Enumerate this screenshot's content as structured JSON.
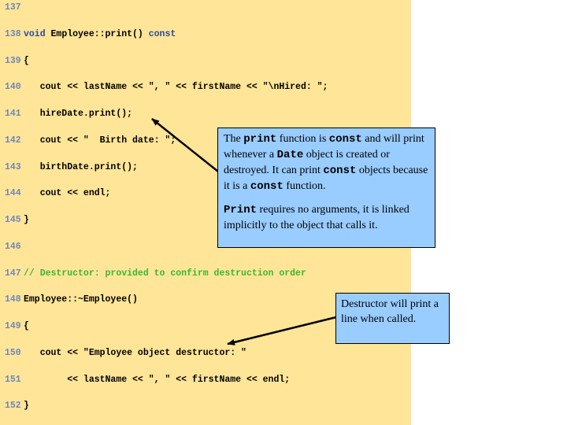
{
  "code": {
    "lines": [
      {
        "num": "137",
        "text": ""
      },
      {
        "num": "138",
        "kw1": "void ",
        "text": "Employee::print() ",
        "kw2": "const"
      },
      {
        "num": "139",
        "text": "{"
      },
      {
        "num": "140",
        "text": "   cout << lastName << \", \" << firstName << \"\\nHired: \";"
      },
      {
        "num": "141",
        "text": "   hireDate.print();"
      },
      {
        "num": "142",
        "text": "   cout << \"  Birth date: \";"
      },
      {
        "num": "143",
        "text": "   birthDate.print();"
      },
      {
        "num": "144",
        "text": "   cout << endl;"
      },
      {
        "num": "145",
        "text": "}"
      },
      {
        "num": "146",
        "text": ""
      },
      {
        "num": "147",
        "comment": "// Destructor: provided to confirm destruction order"
      },
      {
        "num": "148",
        "text": "Employee::~Employee()"
      },
      {
        "num": "149",
        "text": "{"
      },
      {
        "num": "150",
        "text": "   cout << \"Employee object destructor: \""
      },
      {
        "num": "151",
        "text": "        << lastName << \", \" << firstName << endl;"
      },
      {
        "num": "152",
        "text": "}"
      }
    ]
  },
  "callout_print": {
    "p1": [
      "The ",
      "print",
      " function is ",
      "const",
      " and will print whenever a ",
      "Date",
      " object is created or destroyed.  It can print ",
      "const",
      " objects because it is a ",
      "const",
      " function."
    ],
    "p2": [
      "Print",
      " requires no arguments, it is linked implicitly to the object that calls it."
    ]
  },
  "callout_destructor": {
    "text": "Destructor will print a line when called."
  },
  "colors": {
    "code_background": "#ffe597",
    "callout_background": "#99ccff",
    "line_number": "#6f87b9",
    "keyword": "#2a4b9a",
    "comment": "#33bb33"
  }
}
